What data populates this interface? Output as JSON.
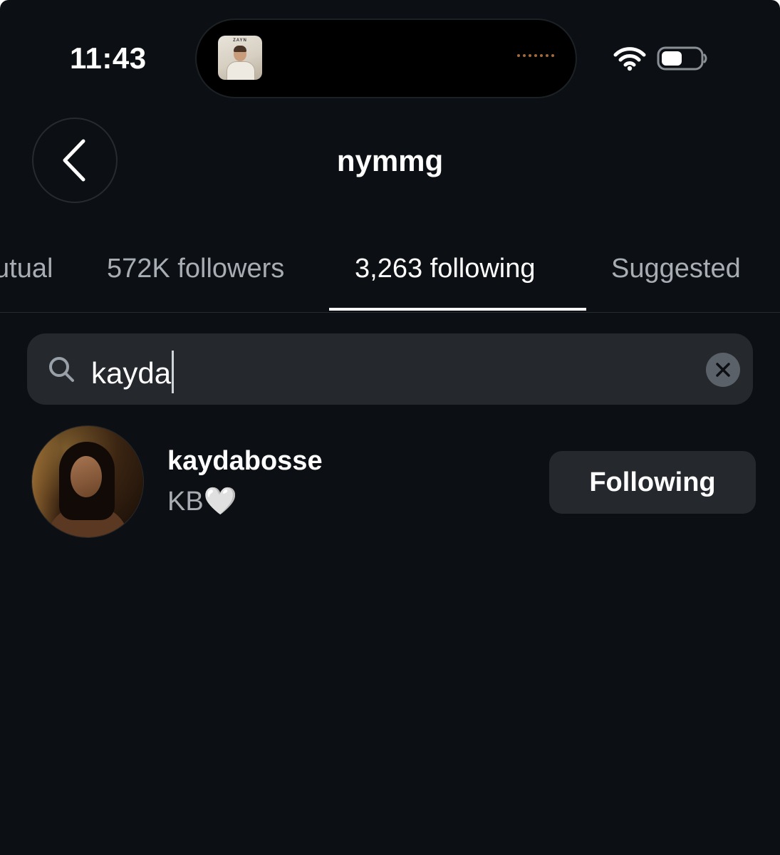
{
  "status_bar": {
    "time": "11:43",
    "now_playing_art_title": "ZAYN"
  },
  "header": {
    "title": "nymmg"
  },
  "tabs": [
    {
      "label": "utual",
      "active": false
    },
    {
      "label": "572K followers",
      "active": false
    },
    {
      "label": "3,263 following",
      "active": true
    },
    {
      "label": "Suggested",
      "active": false
    }
  ],
  "search": {
    "value": "kayda",
    "icon": "search-icon",
    "clear_icon": "close-icon"
  },
  "results": [
    {
      "username": "kaydabosse",
      "full_name": "KB🤍",
      "button_label": "Following"
    }
  ],
  "colors": {
    "background": "#0c1014",
    "surface": "#25292e",
    "text_primary": "#ffffff",
    "text_secondary": "#a8adb4",
    "divider": "#262b31"
  }
}
